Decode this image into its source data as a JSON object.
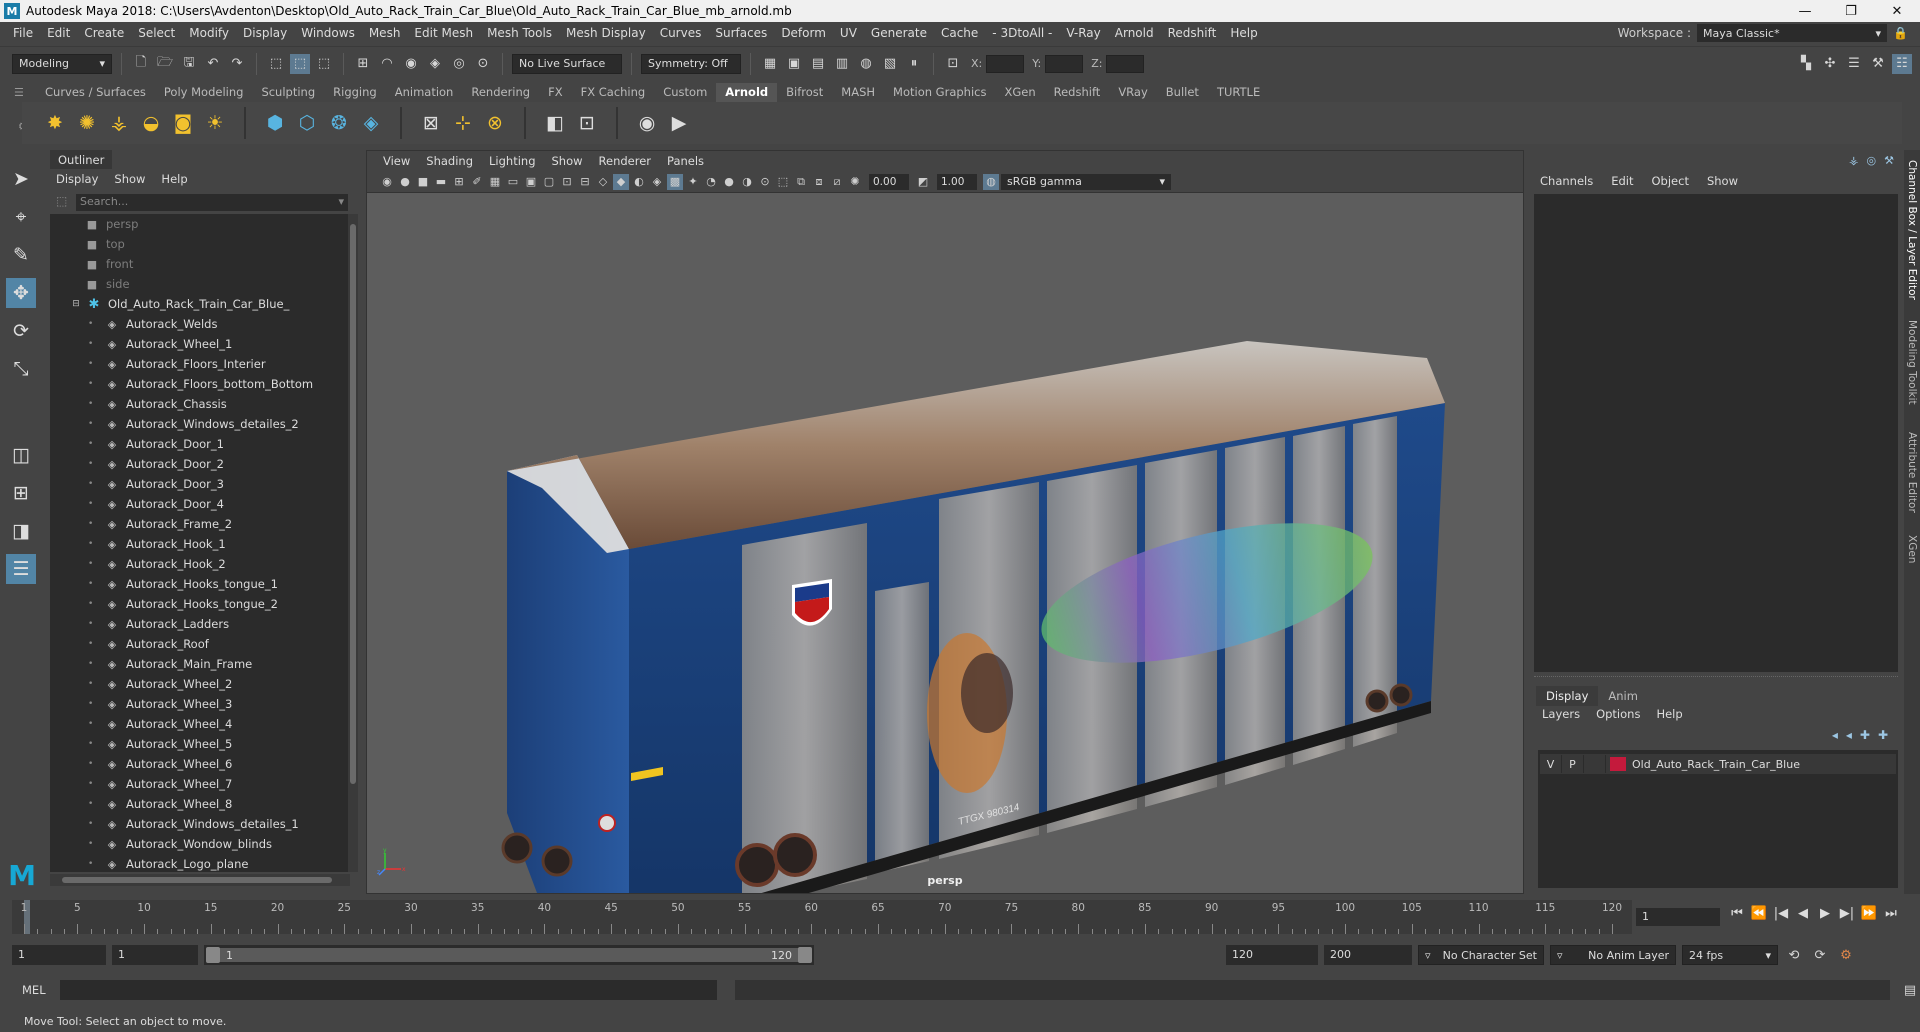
{
  "window": {
    "title": "Autodesk Maya 2018: C:\\Users\\Avdenton\\Desktop\\Old_Auto_Rack_Train_Car_Blue\\Old_Auto_Rack_Train_Car_Blue_mb_arnold.mb",
    "logo": "M",
    "minimize": "—",
    "maximize": "❐",
    "close": "✕"
  },
  "menubar": {
    "items": [
      "File",
      "Edit",
      "Create",
      "Select",
      "Modify",
      "Display",
      "Windows",
      "Mesh",
      "Edit Mesh",
      "Mesh Tools",
      "Mesh Display",
      "Curves",
      "Surfaces",
      "Deform",
      "UV",
      "Generate",
      "Cache",
      "- 3DtoAll -",
      "V-Ray",
      "Arnold",
      "Redshift",
      "Help"
    ],
    "workspace_label": "Workspace :",
    "workspace_value": "Maya Classic*"
  },
  "statusline": {
    "mode": "Modeling",
    "live_surface": "No Live Surface",
    "symmetry": "Symmetry: Off",
    "x_label": "X:",
    "y_label": "Y:",
    "z_label": "Z:"
  },
  "shelf": {
    "tabs": [
      "Curves / Surfaces",
      "Poly Modeling",
      "Sculpting",
      "Rigging",
      "Animation",
      "Rendering",
      "FX",
      "FX Caching",
      "Custom",
      "Arnold",
      "Bifrost",
      "MASH",
      "Motion Graphics",
      "XGen",
      "Redshift",
      "VRay",
      "Bullet",
      "TURTLE"
    ],
    "active_tab": "Arnold"
  },
  "outliner": {
    "title": "Outliner",
    "menu": [
      "Display",
      "Show",
      "Help"
    ],
    "search_placeholder": "Search...",
    "cameras": [
      "persp",
      "top",
      "front",
      "side"
    ],
    "group": "Old_Auto_Rack_Train_Car_Blue_",
    "children": [
      "Autorack_Welds",
      "Autorack_Wheel_1",
      "Autorack_Floors_Interier",
      "Autorack_Floors_bottom_Bottom",
      "Autorack_Chassis",
      "Autorack_Windows_detailes_2",
      "Autorack_Door_1",
      "Autorack_Door_2",
      "Autorack_Door_3",
      "Autorack_Door_4",
      "Autorack_Frame_2",
      "Autorack_Hook_1",
      "Autorack_Hook_2",
      "Autorack_Hooks_tongue_1",
      "Autorack_Hooks_tongue_2",
      "Autorack_Ladders",
      "Autorack_Roof",
      "Autorack_Main_Frame",
      "Autorack_Wheel_2",
      "Autorack_Wheel_3",
      "Autorack_Wheel_4",
      "Autorack_Wheel_5",
      "Autorack_Wheel_6",
      "Autorack_Wheel_7",
      "Autorack_Wheel_8",
      "Autorack_Windows_detailes_1",
      "Autorack_Wondow_blinds",
      "Autorack_Logo_plane"
    ]
  },
  "viewport": {
    "menu": [
      "View",
      "Shading",
      "Lighting",
      "Show",
      "Renderer",
      "Panels"
    ],
    "exposure": "0.00",
    "gamma": "1.00",
    "color_space": "sRGB gamma",
    "camera_label": "persp",
    "car_reporting_mark": "TTGX 980314",
    "axis_x": "x",
    "axis_y": "y",
    "axis_z": "z"
  },
  "channelbox": {
    "menu": [
      "Channels",
      "Edit",
      "Object",
      "Show"
    ],
    "layer_tabs": [
      "Display",
      "Anim"
    ],
    "layer_menu": [
      "Layers",
      "Options",
      "Help"
    ],
    "layer": {
      "v": "V",
      "p": "P",
      "name": "Old_Auto_Rack_Train_Car_Blue",
      "color": "#c41a3c"
    }
  },
  "sidetabs": [
    "Channel Box / Layer Editor",
    "Modeling Toolkit",
    "Attribute Editor",
    "XGen"
  ],
  "timeline": {
    "ticks": [
      1,
      5,
      10,
      15,
      20,
      25,
      30,
      35,
      40,
      45,
      50,
      55,
      60,
      65,
      70,
      75,
      80,
      85,
      90,
      95,
      100,
      105,
      110,
      115,
      120
    ],
    "current_frame": "1"
  },
  "range": {
    "start": "1",
    "playback_start": "1",
    "slider_start": "1",
    "slider_end": "120",
    "playback_end": "120",
    "end": "200",
    "character_set": "No Character Set",
    "anim_layer": "No Anim Layer",
    "fps": "24 fps"
  },
  "commandline": {
    "label": "MEL",
    "help": "Move Tool: Select an object to move."
  }
}
